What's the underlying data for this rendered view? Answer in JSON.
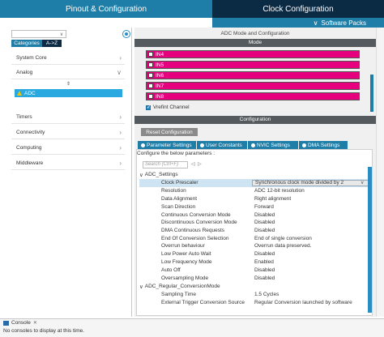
{
  "tabs": {
    "pinout": "Pinout & Configuration",
    "clock": "Clock Configuration"
  },
  "software_packs": {
    "label": "Software Packs",
    "arrow": "∨"
  },
  "left": {
    "categories_tab": "Categories",
    "az_tab": "A->Z",
    "categories": [
      {
        "label": "System Core",
        "chevron": "›"
      },
      {
        "label": "Analog",
        "chevron": "∨"
      },
      {
        "label": "Timers",
        "chevron": "›"
      },
      {
        "label": "Connectivity",
        "chevron": "›"
      },
      {
        "label": "Computing",
        "chevron": "›"
      },
      {
        "label": "Middleware",
        "chevron": "›"
      }
    ],
    "sort_symbol": "⇕",
    "selected_item": "ADC",
    "search_arrow": "∨"
  },
  "right": {
    "mode_title": "ADC Mode and Configuration",
    "mode_header": "Mode",
    "channels": [
      "IN4",
      "IN5",
      "IN6",
      "IN7",
      "IN8"
    ],
    "vrefint": "Vrefint Channel",
    "config_header": "Configuration",
    "reset_button": "Reset Configuration",
    "param_tabs": [
      "Parameter Settings",
      "User Constants",
      "NVIC Settings",
      "DMA Settings"
    ],
    "configure_label": "Configure the below parameters :",
    "search_placeholder": "Search (Ctrl+F)",
    "prev_symbol": "◁",
    "next_symbol": "▷",
    "groups": [
      {
        "name": "ADC_Settings",
        "rows": [
          {
            "name": "Clock Prescaler",
            "value": "Synchronous clock mode divided by 2"
          },
          {
            "name": "Resolution",
            "value": "ADC 12-bit resolution"
          },
          {
            "name": "Data Alignment",
            "value": "Right alignment"
          },
          {
            "name": "Scan Direction",
            "value": "Forward"
          },
          {
            "name": "Continuous Conversion Mode",
            "value": "Disabled"
          },
          {
            "name": "Discontinuous Conversion Mode",
            "value": "Disabled"
          },
          {
            "name": "DMA Continuous Requests",
            "value": "Disabled"
          },
          {
            "name": "End Of Conversion Selection",
            "value": "End of single conversion"
          },
          {
            "name": "Overrun behaviour",
            "value": "Overrun data preserved."
          },
          {
            "name": "Low Power Auto Wait",
            "value": "Disabled"
          },
          {
            "name": "Low Frequency Mode",
            "value": "Enabled"
          },
          {
            "name": "Auto Off",
            "value": "Disabled"
          },
          {
            "name": "Oversampling Mode",
            "value": "Disabled"
          }
        ]
      },
      {
        "name": "ADC_Regular_ConversionMode",
        "rows": [
          {
            "name": "Sampling Time",
            "value": "1.5 Cycles"
          },
          {
            "name": "External Trigger Conversion Source",
            "value": "Regular Conversion launched by software"
          }
        ]
      }
    ],
    "expand_symbol": "∨",
    "dropdown_arrow": "∨"
  },
  "console": {
    "tab": "Console",
    "close": "✕",
    "message": "No consoles to display at this time."
  },
  "colors": {
    "accent": "#1f7ea8",
    "dark": "#0b2a44",
    "channel": "#e6007e",
    "selected": "#29a9e0"
  }
}
